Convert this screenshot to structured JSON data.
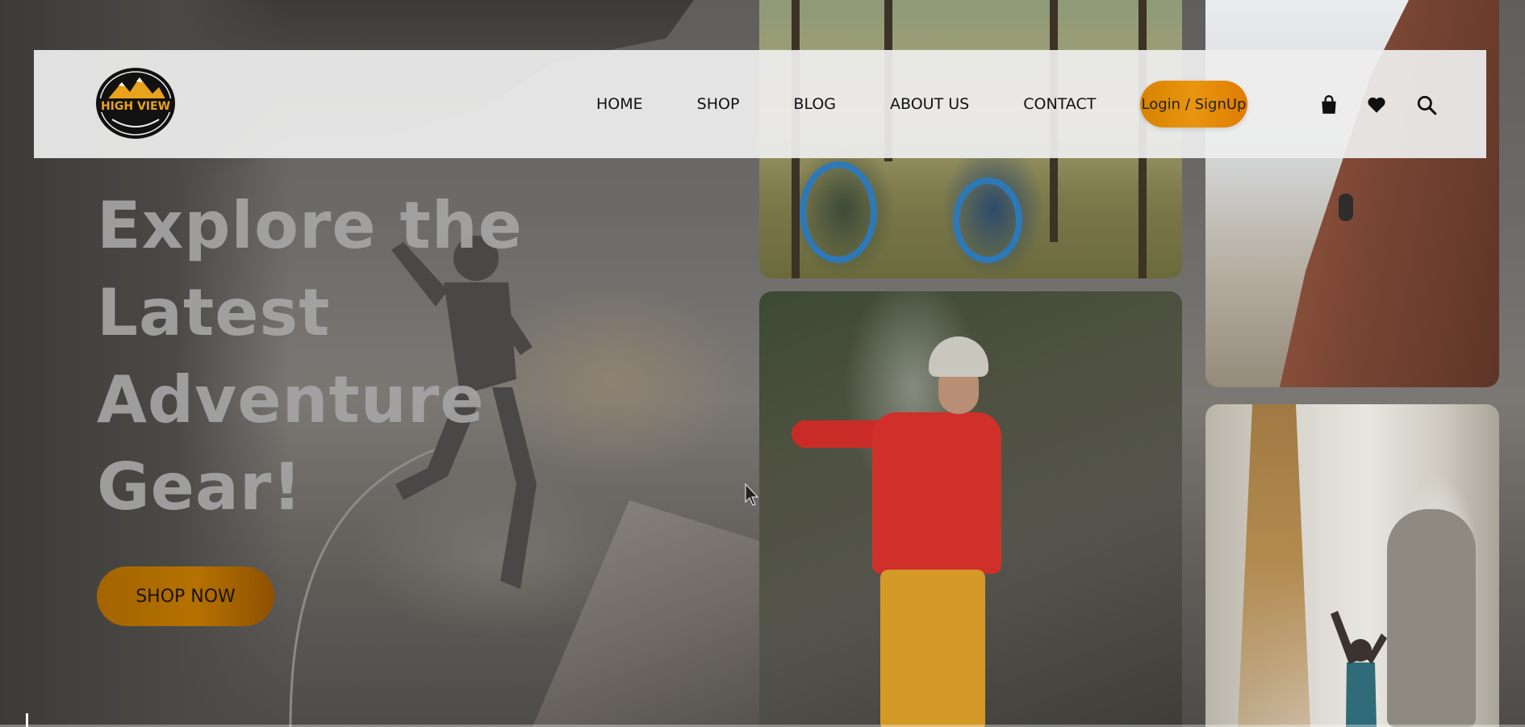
{
  "brand": {
    "name": "HIGH VIEW",
    "accent": "#e9950f",
    "accent_dark": "#b57200"
  },
  "nav": {
    "links": [
      "HOME",
      "SHOP",
      "BLOG",
      "ABOUT US",
      "CONTACT"
    ],
    "login_label": "Login / SignUp",
    "icons": [
      "shopping-bag-icon",
      "heart-icon",
      "search-icon"
    ]
  },
  "hero": {
    "title_lines": [
      "Explore the",
      "Latest",
      "Adventure",
      "Gear!"
    ],
    "cta_label": "SHOP NOW"
  }
}
